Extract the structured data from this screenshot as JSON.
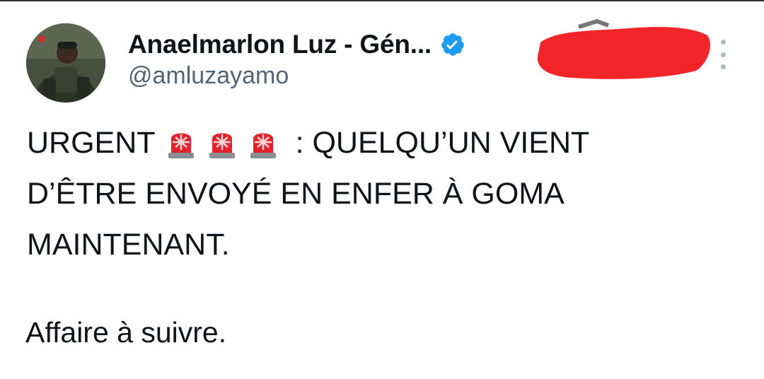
{
  "author": {
    "display_name": "Anaelmarlon Luz - Gén...",
    "handle": "@amluzayamo",
    "verified": true,
    "avatar_icon": "profile-photo"
  },
  "tweet": {
    "urgent_label": "URGENT",
    "emoji_icon": "police-car-light-emoji",
    "emoji_count": 3,
    "line1_rest": ": QUELQU’UN VIENT",
    "line2": "D’ÊTRE ENVOYÉ EN ENFER À GOMA",
    "line3": "MAINTENANT.",
    "follow_up": "Affaire à suivre."
  },
  "colors": {
    "text": "#0f1419",
    "secondary_text": "#536471",
    "verified_blue": "#1d9bf0",
    "redaction_red": "#f2252a"
  }
}
